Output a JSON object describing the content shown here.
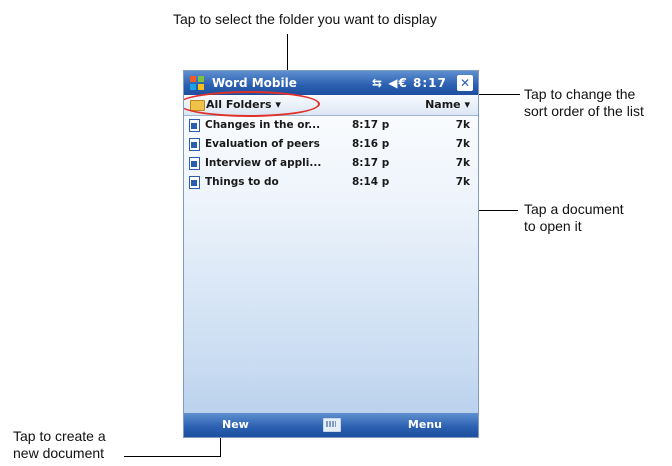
{
  "callouts": {
    "select_folder": "Tap to select the folder you want to display",
    "sort_order_line1": "Tap to change the",
    "sort_order_line2": "sort order of the list",
    "open_doc_line1": "Tap a document",
    "open_doc_line2": "to open it",
    "new_doc_line1": "Tap to create a",
    "new_doc_line2": "new document"
  },
  "titlebar": {
    "app_title": "Word Mobile",
    "status_icons": "⇆ ◀€ 8:17",
    "close": "✕"
  },
  "folderbar": {
    "folder_label": "All Folders ▾",
    "sort_label": "Name ▾"
  },
  "files": [
    {
      "name": "Changes in the or...",
      "time": "8:17 p",
      "size": "7k"
    },
    {
      "name": "Evaluation of peers",
      "time": "8:16 p",
      "size": "7k"
    },
    {
      "name": "Interview of appli...",
      "time": "8:17 p",
      "size": "7k"
    },
    {
      "name": "Things to do",
      "time": "8:14 p",
      "size": "7k"
    }
  ],
  "bottombar": {
    "new_label": "New",
    "menu_label": "Menu"
  },
  "colors": {
    "titlebar": "#2a5fb0",
    "highlight_ellipse": "#e0302a"
  }
}
